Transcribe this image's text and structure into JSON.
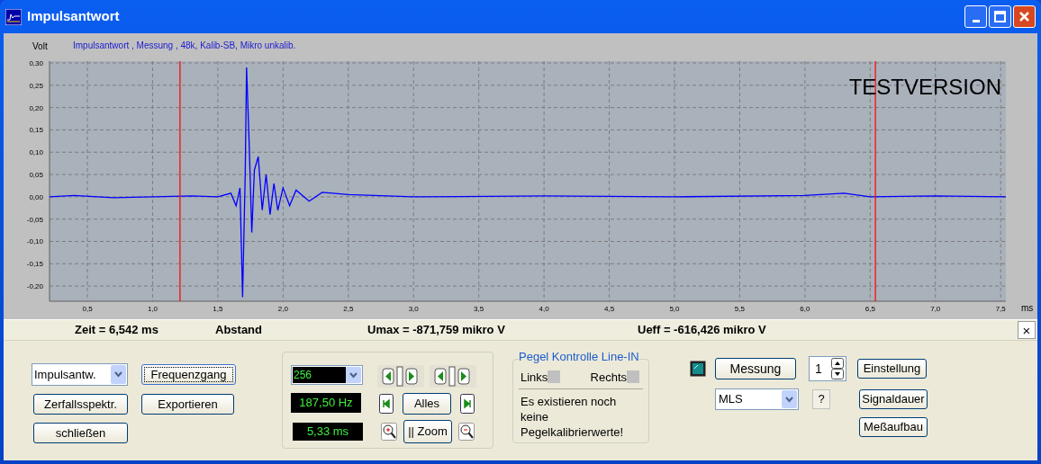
{
  "window": {
    "title": "Impulsantwort"
  },
  "chart": {
    "chart_data": {
      "type": "line",
      "title": "Impulsantwort , Messung , 48k, Kalib-SB, Mikro unkalib.",
      "xlabel": "ms",
      "ylabel": "Volt",
      "x": [
        0.21,
        0.4,
        0.7,
        1.0,
        1.3,
        1.5,
        1.6,
        1.64,
        1.67,
        1.69,
        1.71,
        1.72,
        1.74,
        1.76,
        1.78,
        1.81,
        1.84,
        1.87,
        1.9,
        1.93,
        1.96,
        2.0,
        2.05,
        2.1,
        2.2,
        2.3,
        2.5,
        3.0,
        4.0,
        5.0,
        6.0,
        6.3,
        6.5,
        7.0,
        7.54
      ],
      "series": [
        {
          "color": "#0000ff",
          "values": [
            0,
            0.003,
            -0.002,
            0,
            0.002,
            0,
            0.008,
            -0.02,
            0.02,
            -0.225,
            0.05,
            0.29,
            0.12,
            -0.08,
            0.06,
            0.09,
            -0.03,
            0.05,
            -0.04,
            0.03,
            -0.03,
            0.02,
            -0.02,
            0.015,
            -0.01,
            0.01,
            0.005,
            0,
            0.002,
            0,
            0.003,
            0.008,
            0,
            0.002,
            0
          ]
        }
      ],
      "xlim": [
        0.21,
        7.54
      ],
      "ylim": [
        -0.234,
        0.304
      ],
      "xticks": [
        {
          "value": 0.5,
          "label": "0,5"
        },
        {
          "value": 1.0,
          "label": "1,0"
        },
        {
          "value": 1.5,
          "label": "1,5"
        },
        {
          "value": 2.0,
          "label": "2,0"
        },
        {
          "value": 2.5,
          "label": "2,5"
        },
        {
          "value": 3.0,
          "label": "3,0"
        },
        {
          "value": 3.5,
          "label": "3,5"
        },
        {
          "value": 4.0,
          "label": "4,0"
        },
        {
          "value": 4.5,
          "label": "4,5"
        },
        {
          "value": 5.0,
          "label": "5,0"
        },
        {
          "value": 5.5,
          "label": "5,5"
        },
        {
          "value": 6.0,
          "label": "6,0"
        },
        {
          "value": 6.5,
          "label": "6,5"
        },
        {
          "value": 7.0,
          "label": "7,0"
        },
        {
          "value": 7.5,
          "label": "7,5"
        }
      ],
      "yticks": [
        {
          "value": 0.3,
          "label": "0,30"
        },
        {
          "value": 0.25,
          "label": "0,25"
        },
        {
          "value": 0.2,
          "label": "0,20"
        },
        {
          "value": 0.15,
          "label": "0,15"
        },
        {
          "value": 0.1,
          "label": "0,10"
        },
        {
          "value": 0.05,
          "label": "0,05"
        },
        {
          "value": 0,
          "label": "0,00"
        },
        {
          "value": -0.05,
          "label": "-0,05"
        },
        {
          "value": -0.1,
          "label": "-0,10"
        },
        {
          "value": -0.15,
          "label": "-0,15"
        },
        {
          "value": -0.2,
          "label": "-0,20"
        }
      ],
      "grid": true,
      "ref_lines": [
        {
          "axis": "x",
          "value": 1.21,
          "color": "#ff0000"
        },
        {
          "axis": "x",
          "value": 6.54,
          "color": "#ff0000"
        }
      ],
      "annotations": [
        {
          "text": "TESTVERSION"
        }
      ]
    }
  },
  "status_bar": {
    "items": [
      "Zeit = 6,542 ms",
      "Abstand",
      "Umax = -871,759 mikro V",
      "Ueff = -616,426 mikro V"
    ],
    "close": "×"
  },
  "controls": {
    "view_select": {
      "value": "Impulsantw."
    },
    "buttons": [
      {
        "label": "Frequenzgang",
        "focused": true
      },
      {
        "label": "Zerfallsspektr.",
        "focused": false
      },
      {
        "label": "Exportieren",
        "focused": false
      },
      {
        "label": "schließen",
        "focused": false
      }
    ]
  },
  "navigation": {
    "points_select": {
      "value": "256"
    },
    "frequency": "187,50 Hz",
    "duration": "5,33 ms",
    "all_button": "Alles",
    "zoom_button": "|| Zoom"
  },
  "level_check": {
    "title": "Pegel Kontrolle Line-IN",
    "channels": [
      {
        "label": "Links",
        "checked": false
      },
      {
        "label": "Rechts",
        "checked": false
      }
    ],
    "message": "Es existieren noch keine Pegelkalibrierwerte!"
  },
  "measurement": {
    "measure_button": "Messung",
    "repeat": "1",
    "settings_button": "Einstellung",
    "signal_select": {
      "value": "MLS"
    },
    "help_button": "?",
    "duration_button": "Signaldauer",
    "setup_button": "Meßaufbau"
  }
}
